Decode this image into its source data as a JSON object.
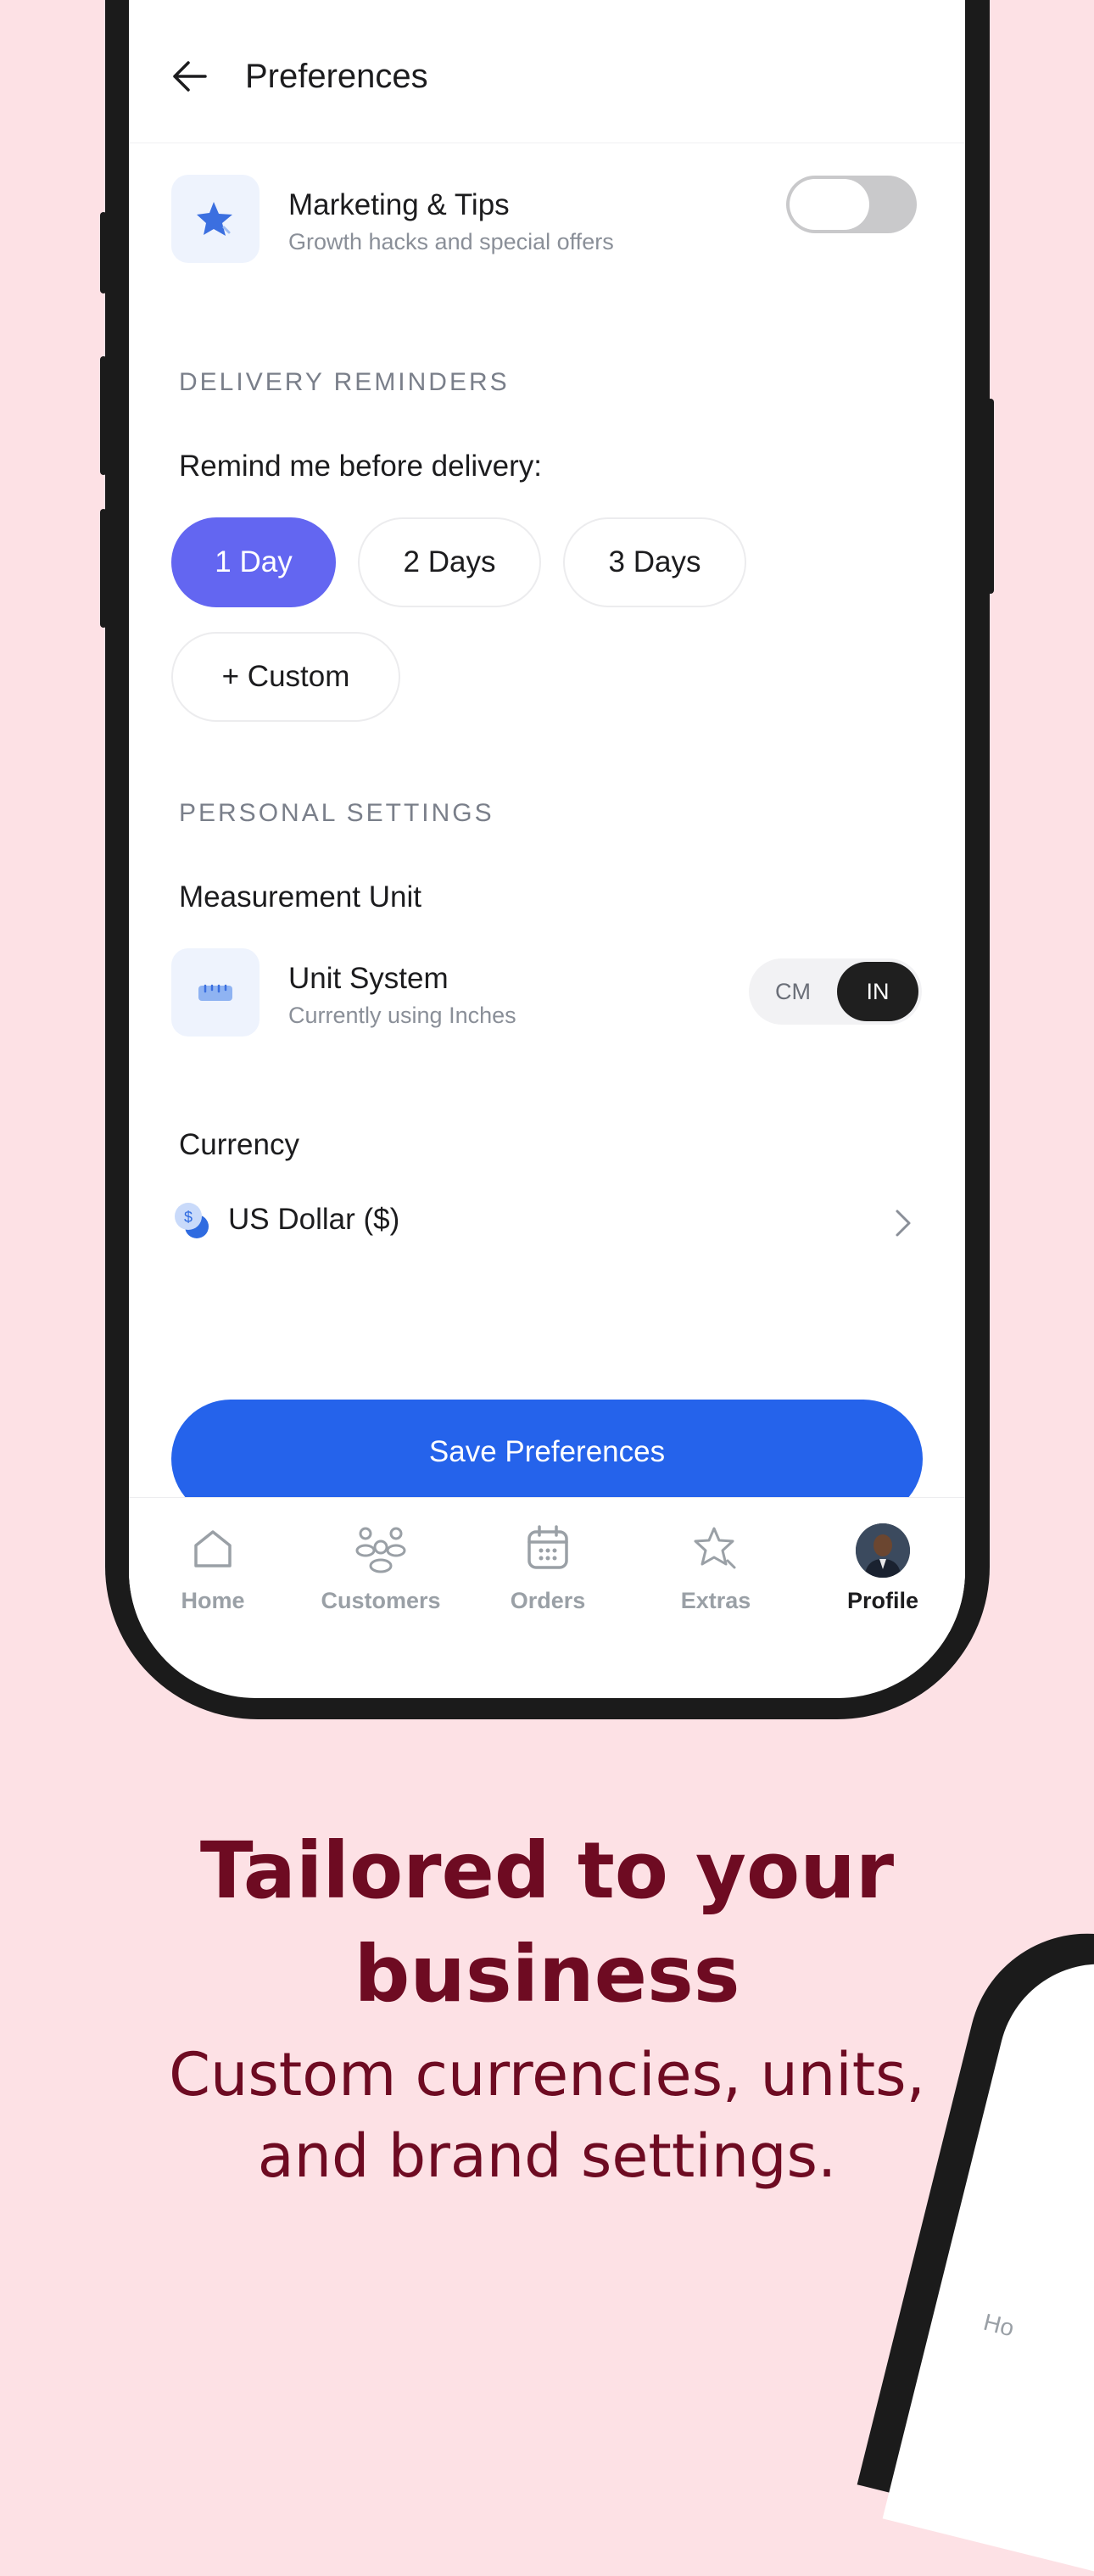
{
  "header": {
    "title": "Preferences"
  },
  "marketing": {
    "title": "Marketing & Tips",
    "subtitle": "Growth hacks and special offers",
    "enabled": false
  },
  "delivery": {
    "section_title": "DELIVERY REMINDERS",
    "prompt": "Remind me before delivery:",
    "options": [
      "1 Day",
      "2 Days",
      "3 Days"
    ],
    "selected": "1 Day",
    "custom_label": "+ Custom"
  },
  "personal": {
    "section_title": "PERSONAL SETTINGS",
    "measurement_label": "Measurement Unit",
    "unit_title": "Unit System",
    "unit_subtitle": "Currently using Inches",
    "unit_options": [
      "CM",
      "IN"
    ],
    "unit_selected": "IN",
    "currency_label": "Currency",
    "currency_value": "US Dollar ($)"
  },
  "save_label": "Save Preferences",
  "tabs": [
    "Home",
    "Customers",
    "Orders",
    "Extras",
    "Profile"
  ],
  "active_tab": "Profile",
  "marketing_copy": {
    "headline_line1": "Tailored to your",
    "headline_line2": "business",
    "subline_line1": "Custom currencies, units,",
    "subline_line2": "and brand settings."
  },
  "second_phone": {
    "tab_label_fragment": "Ho"
  },
  "colors": {
    "accent": "#6366f1",
    "primary": "#2563eb",
    "headline": "#6e0b22",
    "background": "#fde1e5"
  }
}
